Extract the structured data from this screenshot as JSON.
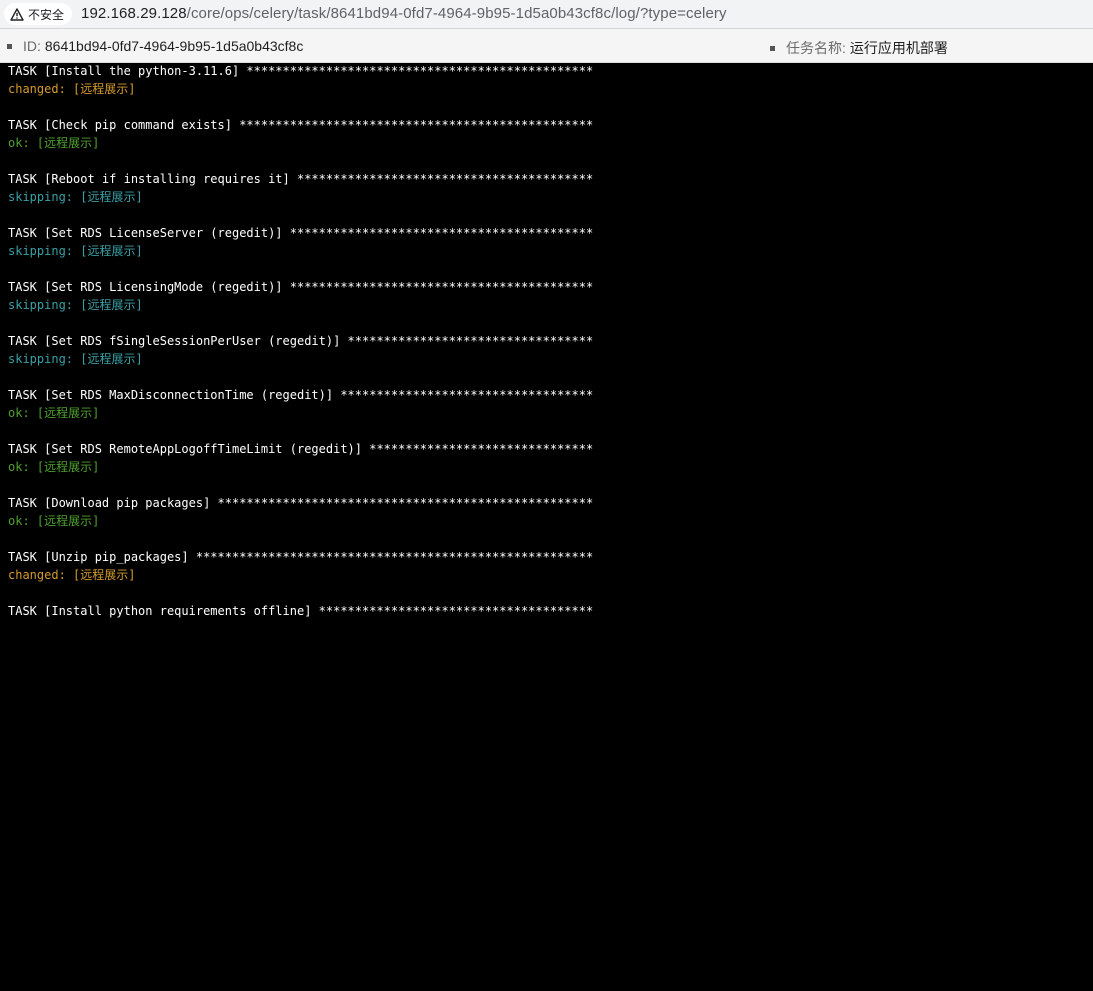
{
  "browser": {
    "security_label": "不安全",
    "url_host": "192.168.29.128",
    "url_path": "/core/ops/celery/task/8641bd94-0fd7-4964-9b95-1d5a0b43cf8c/log/?type=celery"
  },
  "info_bar": {
    "id_label": "ID:",
    "id_value": "8641bd94-0fd7-4964-9b95-1d5a0b43cf8c",
    "task_name_label": "任务名称:",
    "task_name_value": "运行应用机部署"
  },
  "status_colors": {
    "changed": "#d49b2c",
    "ok": "#4fa12e",
    "skipping": "#3aa0a6",
    "task": "#ffffff"
  },
  "log_lines": [
    {
      "kind": "task",
      "text": "TASK [Install the python-3.11.6] ************************************************"
    },
    {
      "kind": "changed",
      "text": "changed: [远程展示]"
    },
    {
      "kind": "blank",
      "text": ""
    },
    {
      "kind": "task",
      "text": "TASK [Check pip command exists] *************************************************"
    },
    {
      "kind": "ok",
      "text": "ok: [远程展示]"
    },
    {
      "kind": "blank",
      "text": ""
    },
    {
      "kind": "task",
      "text": "TASK [Reboot if installing requires it] *****************************************"
    },
    {
      "kind": "skipping",
      "text": "skipping: [远程展示]"
    },
    {
      "kind": "blank",
      "text": ""
    },
    {
      "kind": "task",
      "text": "TASK [Set RDS LicenseServer (regedit)] ******************************************"
    },
    {
      "kind": "skipping",
      "text": "skipping: [远程展示]"
    },
    {
      "kind": "blank",
      "text": ""
    },
    {
      "kind": "task",
      "text": "TASK [Set RDS LicensingMode (regedit)] ******************************************"
    },
    {
      "kind": "skipping",
      "text": "skipping: [远程展示]"
    },
    {
      "kind": "blank",
      "text": ""
    },
    {
      "kind": "task",
      "text": "TASK [Set RDS fSingleSessionPerUser (regedit)] **********************************"
    },
    {
      "kind": "skipping",
      "text": "skipping: [远程展示]"
    },
    {
      "kind": "blank",
      "text": ""
    },
    {
      "kind": "task",
      "text": "TASK [Set RDS MaxDisconnectionTime (regedit)] ***********************************"
    },
    {
      "kind": "ok",
      "text": "ok: [远程展示]"
    },
    {
      "kind": "blank",
      "text": ""
    },
    {
      "kind": "task",
      "text": "TASK [Set RDS RemoteAppLogoffTimeLimit (regedit)] *******************************"
    },
    {
      "kind": "ok",
      "text": "ok: [远程展示]"
    },
    {
      "kind": "blank",
      "text": ""
    },
    {
      "kind": "task",
      "text": "TASK [Download pip packages] ****************************************************"
    },
    {
      "kind": "ok",
      "text": "ok: [远程展示]"
    },
    {
      "kind": "blank",
      "text": ""
    },
    {
      "kind": "task",
      "text": "TASK [Unzip pip_packages] *******************************************************"
    },
    {
      "kind": "changed",
      "text": "changed: [远程展示]"
    },
    {
      "kind": "blank",
      "text": ""
    },
    {
      "kind": "task",
      "text": "TASK [Install python requirements offline] **************************************"
    }
  ]
}
